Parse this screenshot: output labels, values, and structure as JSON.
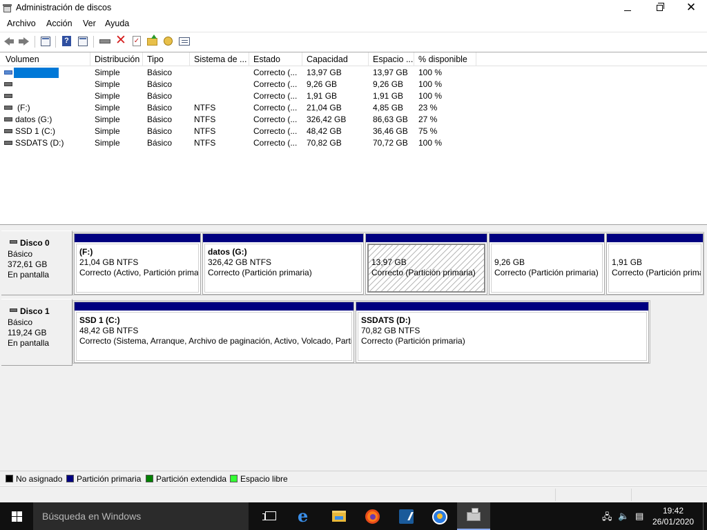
{
  "window": {
    "title": "Administración de discos",
    "controls": {
      "minimize": "—",
      "maximize": "",
      "close": "✕"
    }
  },
  "menu": [
    "Archivo",
    "Acción",
    "Ver",
    "Ayuda"
  ],
  "toolbar": [
    "back-icon",
    "forward-icon",
    "console-tree-icon",
    "help-icon",
    "properties-icon",
    "connect-drive-icon",
    "delete-icon",
    "check-icon",
    "up-folder-icon",
    "search-folder-icon",
    "list-icon"
  ],
  "volumes": {
    "columns": [
      "Volumen",
      "Distribución",
      "Tipo",
      "Sistema de ...",
      "Estado",
      "Capacidad",
      "Espacio ...",
      "% disponible"
    ],
    "rows": [
      {
        "volume": "",
        "layout": "Simple",
        "type": "Básico",
        "fs": "",
        "status": "Correcto (...",
        "capacity": "13,97 GB",
        "free": "13,97 GB",
        "pct": "100 %"
      },
      {
        "volume": "",
        "layout": "Simple",
        "type": "Básico",
        "fs": "",
        "status": "Correcto (...",
        "capacity": "9,26 GB",
        "free": "9,26 GB",
        "pct": "100 %"
      },
      {
        "volume": "",
        "layout": "Simple",
        "type": "Básico",
        "fs": "",
        "status": "Correcto (...",
        "capacity": "1,91 GB",
        "free": "1,91 GB",
        "pct": "100 %"
      },
      {
        "volume": "(F:)",
        "layout": "Simple",
        "type": "Básico",
        "fs": "NTFS",
        "status": "Correcto (...",
        "capacity": "21,04 GB",
        "free": "4,85 GB",
        "pct": "23 %"
      },
      {
        "volume": "datos (G:)",
        "layout": "Simple",
        "type": "Básico",
        "fs": "NTFS",
        "status": "Correcto (...",
        "capacity": "326,42 GB",
        "free": "86,63 GB",
        "pct": "27 %"
      },
      {
        "volume": "SSD 1 (C:)",
        "layout": "Simple",
        "type": "Básico",
        "fs": "NTFS",
        "status": "Correcto (...",
        "capacity": "48,42 GB",
        "free": "36,46 GB",
        "pct": "75 %"
      },
      {
        "volume": "SSDATS (D:)",
        "layout": "Simple",
        "type": "Básico",
        "fs": "NTFS",
        "status": "Correcto (...",
        "capacity": "70,82 GB",
        "free": "70,72 GB",
        "pct": "100 %"
      }
    ]
  },
  "disks": [
    {
      "name": "Disco 0",
      "type": "Básico",
      "size": "372,61 GB",
      "state": "En pantalla",
      "partitions": [
        {
          "title": "(F:)",
          "size": "21,04 GB NTFS",
          "status": "Correcto (Activo, Partición primaria)",
          "selected": false
        },
        {
          "title": "datos  (G:)",
          "size": "326,42 GB NTFS",
          "status": "Correcto (Partición primaria)",
          "selected": false
        },
        {
          "title": "",
          "size": "13,97 GB",
          "status": "Correcto (Partición primaria)",
          "selected": true
        },
        {
          "title": "",
          "size": "9,26 GB",
          "status": "Correcto (Partición primaria)",
          "selected": false
        },
        {
          "title": "",
          "size": "1,91 GB",
          "status": "Correcto (Partición primaria)",
          "selected": false
        }
      ]
    },
    {
      "name": "Disco 1",
      "type": "Básico",
      "size": "119,24 GB",
      "state": "En pantalla",
      "partitions": [
        {
          "title": "SSD 1  (C:)",
          "size": "48,42 GB NTFS",
          "status": "Correcto (Sistema, Arranque, Archivo de paginación, Activo, Volcado, Partición primaria)",
          "selected": false
        },
        {
          "title": "SSDATS  (D:)",
          "size": "70,82 GB NTFS",
          "status": "Correcto (Partición primaria)",
          "selected": false
        }
      ]
    }
  ],
  "legend": [
    {
      "label": "No asignado",
      "color": "#000000"
    },
    {
      "label": "Partición primaria",
      "color": "#000080"
    },
    {
      "label": "Partición extendida",
      "color": "#008000"
    },
    {
      "label": "Espacio libre",
      "color": "#33ff33"
    }
  ],
  "colors": {
    "partition_bar": "#000080",
    "selection": "#0078d7"
  },
  "taskbar": {
    "search_placeholder": "Búsqueda en Windows",
    "apps": [
      "task-view-icon",
      "edge-icon",
      "file-explorer-icon",
      "firefox-icon",
      "app-icon",
      "app-icon",
      "disk-management-icon"
    ],
    "tray": [
      "network-icon",
      "volume-icon",
      "notifications-icon"
    ],
    "time": "19:42",
    "date": "26/01/2020"
  }
}
